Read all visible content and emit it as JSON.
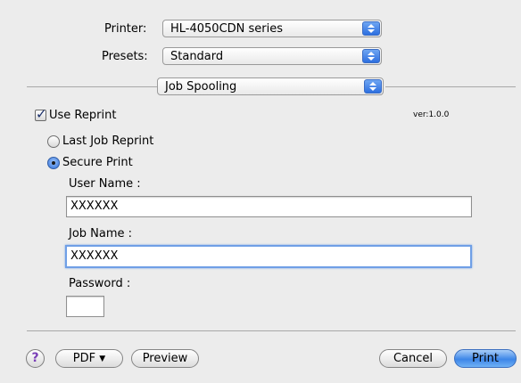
{
  "printer": {
    "label": "Printer:",
    "value": "HL-4050CDN series"
  },
  "presets": {
    "label": "Presets:",
    "value": "Standard"
  },
  "panel": {
    "value": "Job Spooling"
  },
  "version": "ver:1.0.0",
  "use_reprint": {
    "label": "Use Reprint",
    "checked": true
  },
  "options": {
    "last_job": {
      "label": "Last Job Reprint",
      "selected": false
    },
    "secure": {
      "label": "Secure Print",
      "selected": true
    }
  },
  "user_name": {
    "label": "User Name :",
    "value": "XXXXXX"
  },
  "job_name": {
    "label": "Job Name :",
    "value": "XXXXXX"
  },
  "password": {
    "label": "Password :",
    "value": ""
  },
  "buttons": {
    "help": "?",
    "pdf": "PDF",
    "preview": "Preview",
    "cancel": "Cancel",
    "print": "Print"
  }
}
